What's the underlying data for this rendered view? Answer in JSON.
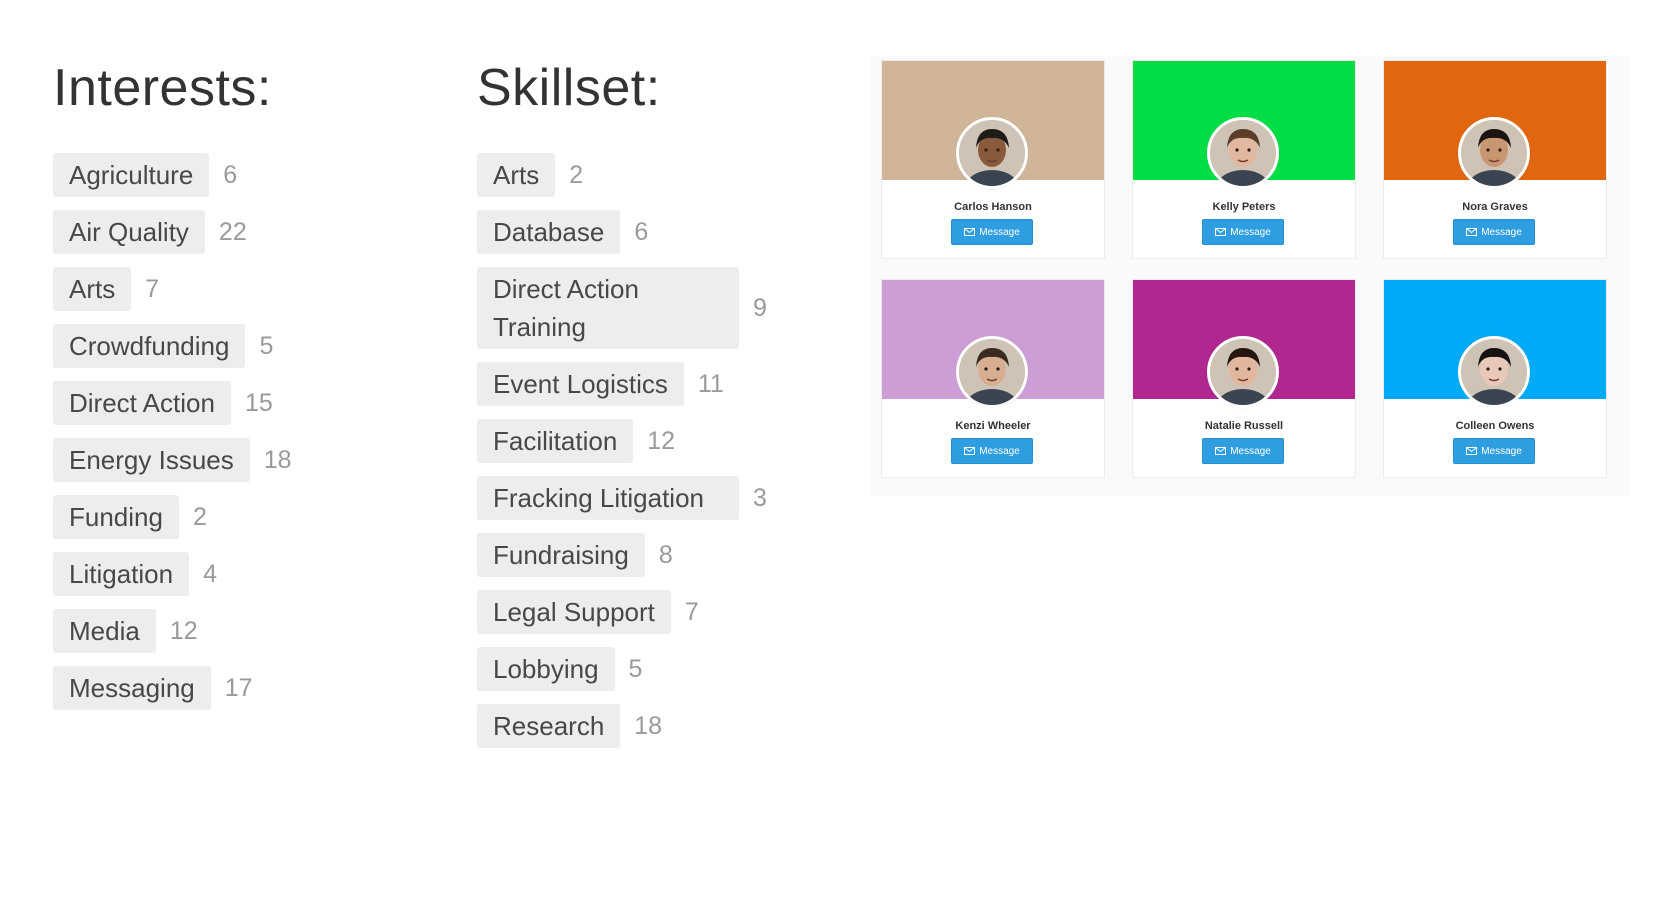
{
  "interests": {
    "title": "Interests:",
    "items": [
      {
        "label": "Agriculture",
        "count": "6"
      },
      {
        "label": "Air Quality",
        "count": "22"
      },
      {
        "label": "Arts",
        "count": "7"
      },
      {
        "label": "Crowdfunding",
        "count": "5"
      },
      {
        "label": "Direct Action",
        "count": "15"
      },
      {
        "label": "Energy Issues",
        "count": "18"
      },
      {
        "label": "Funding",
        "count": "2"
      },
      {
        "label": "Litigation",
        "count": "4"
      },
      {
        "label": "Media",
        "count": "12"
      },
      {
        "label": "Messaging",
        "count": "17"
      }
    ]
  },
  "skillset": {
    "title": "Skillset:",
    "items": [
      {
        "label": "Arts",
        "count": "2"
      },
      {
        "label": "Database",
        "count": "6"
      },
      {
        "label": "Direct Action Training",
        "count": "9"
      },
      {
        "label": "Event Logistics",
        "count": "11"
      },
      {
        "label": "Facilitation",
        "count": "12"
      },
      {
        "label": "Fracking Litigation",
        "count": "3"
      },
      {
        "label": "Fundraising",
        "count": "8"
      },
      {
        "label": "Legal Support",
        "count": "7"
      },
      {
        "label": "Lobbying",
        "count": "5"
      },
      {
        "label": "Research",
        "count": "18"
      }
    ]
  },
  "people": {
    "button_label": "Message",
    "button_icon": "envelope-icon",
    "cards": [
      {
        "name": "Carlos Hanson",
        "banner_color": "#d0b599",
        "skin": "#8a5a3c",
        "hair": "#1e1a18"
      },
      {
        "name": "Kelly Peters",
        "banner_color": "#00dd45",
        "skin": "#e2b9a0",
        "hair": "#5b3d2a"
      },
      {
        "name": "Nora Graves",
        "banner_color": "#e0660f",
        "skin": "#c99672",
        "hair": "#1c1411"
      },
      {
        "name": "Kenzi Wheeler",
        "banner_color": "#cd9dd6",
        "skin": "#d7ae92",
        "hair": "#3b2a22"
      },
      {
        "name": "Natalie Russell",
        "banner_color": "#b0278f",
        "skin": "#e3b79d",
        "hair": "#24160f"
      },
      {
        "name": "Colleen Owens",
        "banner_color": "#00aaf6",
        "skin": "#e8c8b8",
        "hair": "#151212"
      }
    ]
  }
}
